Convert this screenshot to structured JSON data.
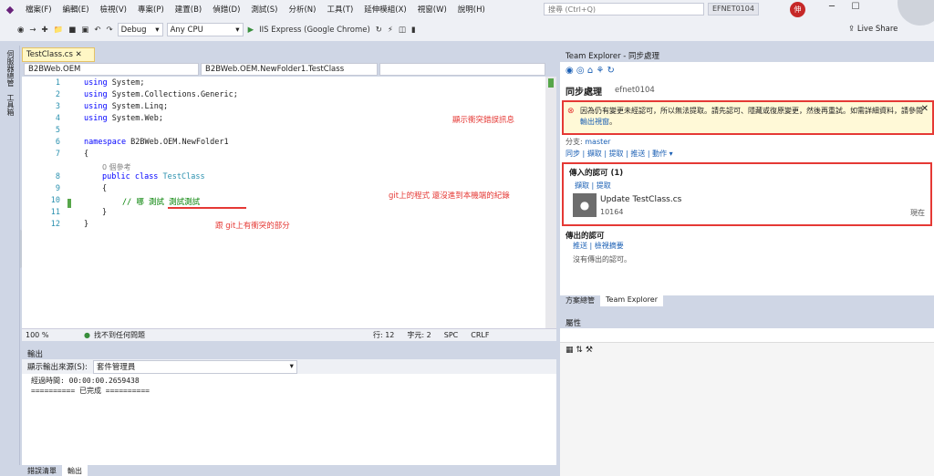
{
  "menu": {
    "items": [
      "檔案(F)",
      "編輯(E)",
      "檢視(V)",
      "專案(P)",
      "建置(B)",
      "偵錯(D)",
      "測試(S)",
      "分析(N)",
      "工具(T)",
      "延伸模組(X)",
      "視窗(W)",
      "說明(H)"
    ],
    "search_placeholder": "搜尋 (Ctrl+Q)",
    "user_label": "EFNET0104",
    "avatar_label": "伸"
  },
  "toolbar": {
    "config": "Debug",
    "platform": "Any CPU",
    "run_label": "IIS Express (Google Chrome)",
    "live_share": "Live Share"
  },
  "side_tabs": [
    "伺服器總管",
    "工具箱"
  ],
  "editor": {
    "tab": "TestClass.cs",
    "nav_left": "B2BWeb.OEM",
    "nav_right": "B2BWeb.OEM.NewFolder1.TestClass",
    "lines": [
      "1",
      "2",
      "3",
      "4",
      "5",
      "6",
      "7",
      "8",
      "9",
      "10",
      "11",
      "12"
    ],
    "code": {
      "l1a": "using",
      "l1b": " System;",
      "l2a": "using",
      "l2b": " System.Collections.Generic;",
      "l3a": "using",
      "l3b": " System.Linq;",
      "l4a": "using",
      "l4b": " System.Web;",
      "l6a": "namespace",
      "l6b": " B2BWeb.OEM.NewFolder1",
      "l7": "{",
      "ref": "0 個參考",
      "l8a": "public",
      "l8b": " class ",
      "l8c": "TestClass",
      "l9": "{",
      "l10a": "//",
      "l10b": " 哪 測試 測試測試",
      "l11": "}",
      "l12": "}"
    },
    "annotation_git": "git上的程式 還沒進到本機端的紀錄",
    "annotation_conflict": "跟 git上有衝突的部分",
    "zoom": "100 %",
    "issues": "找不到任何問題",
    "line": "行: 12",
    "col": "字元: 2",
    "mode": "SPC",
    "eol": "CRLF"
  },
  "team_explorer": {
    "title": "Team Explorer - 同步處理",
    "section": "同步處理",
    "repo": "efnet0104",
    "error_text": "因為仍有變更未經認可，所以無法提取。請先認可、隱藏或復原變更，然後再重試。如需詳細資料，請參閱",
    "error_link": "輸出視窗",
    "error_tail": "。",
    "error_annotation": "顯示衝突錯誤訊息",
    "branch_label": "分支:",
    "branch": "master",
    "actions": [
      "同步",
      "擷取",
      "提取",
      "推送",
      "動作 ▾"
    ],
    "incoming_title": "傳入的認可 (1)",
    "incoming_actions": [
      "擷取",
      "提取"
    ],
    "commit_title": "Update TestClass.cs",
    "commit_id": "10164",
    "commit_time": "現在",
    "outgoing_title": "傳出的認可",
    "outgoing_actions": [
      "推送",
      "檢視摘要"
    ],
    "outgoing_empty": "沒有傳出的認可。",
    "tabs": [
      "方案總管",
      "Team Explorer"
    ]
  },
  "properties": {
    "title": "屬性"
  },
  "output": {
    "title": "輸出",
    "source_label": "顯示輸出來源(S):",
    "source_value": "套件管理員",
    "lines": [
      "經過時間: 00:00:00.2659438",
      "========== 已完成 =========="
    ]
  },
  "bottom_tabs": [
    "錯誤清單",
    "輸出"
  ],
  "colors": {
    "accent": "#e53935",
    "link": "#1a5fb4",
    "keyword": "#0000ff",
    "type": "#2b91af",
    "comment": "#008000"
  }
}
